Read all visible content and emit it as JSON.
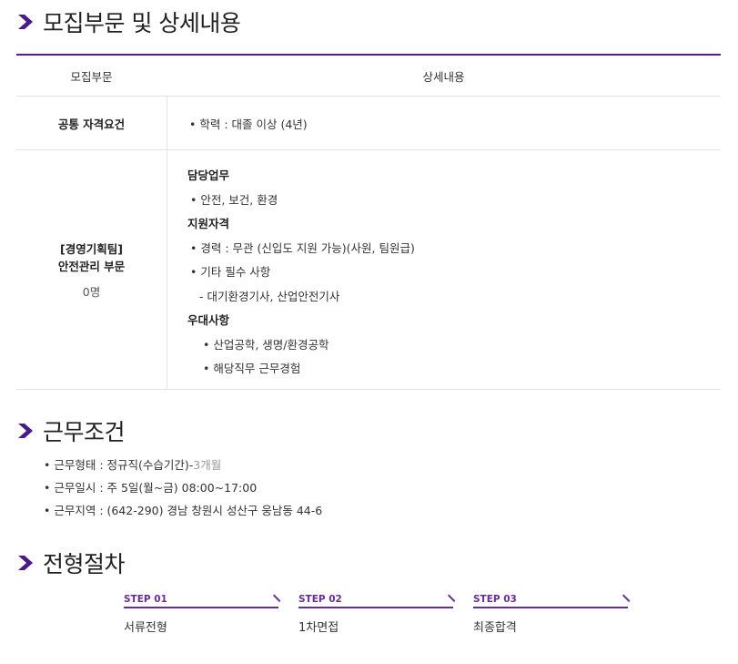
{
  "sections": {
    "recruit_title": "모집부문 및 상세내용",
    "conditions_title": "근무조건",
    "process_title": "전형절차"
  },
  "table": {
    "head_col1": "모집부문",
    "head_col2": "상세내용",
    "row1": {
      "label": "공통 자격요건",
      "detail": "• 학력 : 대졸 이상 (4년)"
    },
    "row2": {
      "label_line1": "[경영기획팀]",
      "label_line2": "안전관리 부문",
      "count": "0명",
      "duty_heading": "담당업무",
      "duty_item": "• 안전, 보건, 환경",
      "qual_heading": "지원자격",
      "qual_item1": "• 경력 : 무관 (신입도 지원 가능)(사원, 팀원급)",
      "qual_item2": "• 기타 필수 사항",
      "qual_sub": "- 대기환경기사, 산업안전기사",
      "pref_heading": "우대사항",
      "pref_item1": "• 산업공학, 생명/환경공학",
      "pref_item2": "• 해당직무 근무경험"
    }
  },
  "conditions": {
    "type_prefix": "• 근무형태 : 정규직(수습기간)-",
    "type_suffix": "3개월",
    "hours": "• 근무일시 : 주 5일(월~금) 08:00~17:00",
    "location": "• 근무지역 : (642-290) 경남 창원시 성산구 웅남동 44-6"
  },
  "steps": [
    {
      "label": "STEP 01",
      "name": "서류전형"
    },
    {
      "label": "STEP 02",
      "name": "1차면접"
    },
    {
      "label": "STEP 03",
      "name": "최종합격"
    }
  ],
  "colors": {
    "accent": "#5b1a8f",
    "chevron": "#4b1a8a"
  }
}
